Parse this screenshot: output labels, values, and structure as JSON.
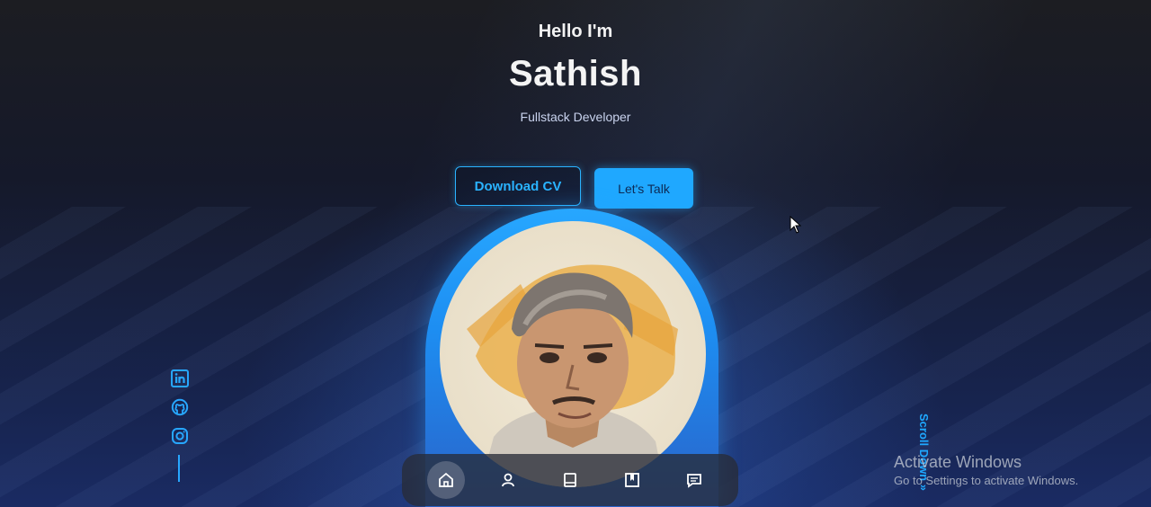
{
  "hero": {
    "greeting": "Hello I'm",
    "name": "Sathish",
    "role": "Fullstack Developer"
  },
  "buttons": {
    "download_cv": "Download CV",
    "lets_talk": "Let's Talk"
  },
  "social": {
    "icons": [
      "linkedin-icon",
      "github-icon",
      "instagram-icon"
    ]
  },
  "scroll": {
    "label": "Scroll Down »"
  },
  "nav": {
    "items": [
      "home-icon",
      "user-icon",
      "book-icon",
      "bookmark-icon",
      "message-icon"
    ],
    "active_index": 0
  },
  "watermark": {
    "title": "Activate Windows",
    "subtitle": "Go to Settings to activate Windows."
  },
  "colors": {
    "accent": "#1fa8ff",
    "background_dark": "#15192a",
    "background_blue": "#1a2b63"
  }
}
